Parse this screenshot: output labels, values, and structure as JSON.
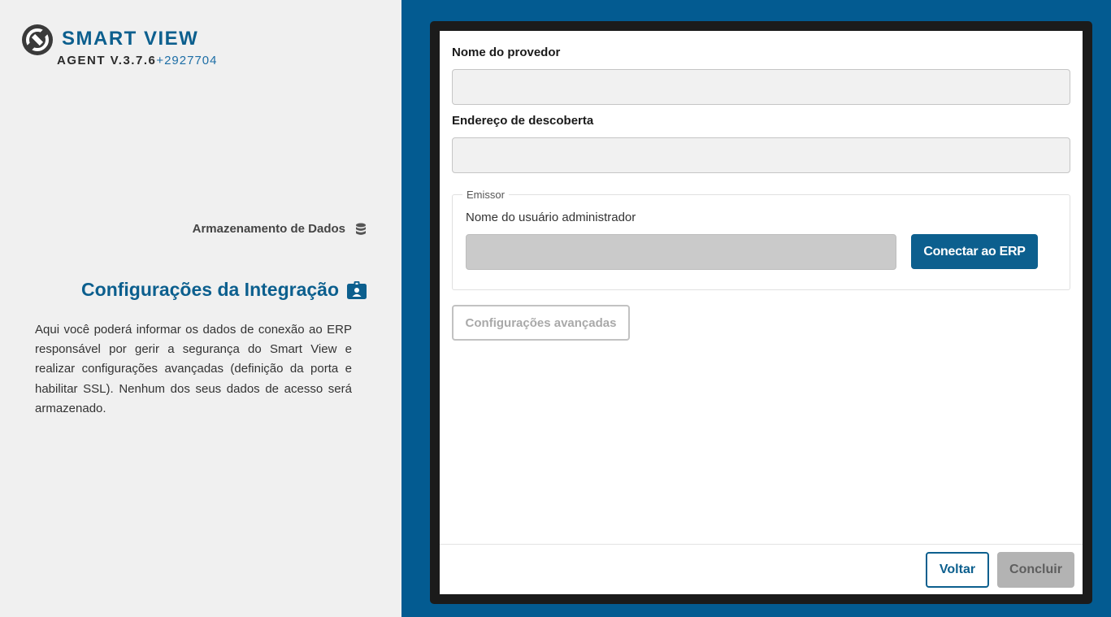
{
  "brand": {
    "name": "SMART VIEW",
    "agent": "AGENT V.3.7.6",
    "build": "+2927704",
    "logo_icon": "totvs-logo-icon"
  },
  "steps": {
    "storage": {
      "label": "Armazenamento de Dados",
      "icon": "database-icon"
    },
    "integration": {
      "label": "Configurações da Integração",
      "icon": "id-badge-icon"
    }
  },
  "description": "Aqui você poderá informar os dados de conexão ao ERP responsável por gerir a segurança do Smart View e realizar configurações avançadas (definição da porta e habilitar SSL). Nenhum dos seus dados de acesso será armazenado.",
  "form": {
    "provider_label": "Nome do provedor",
    "provider_value": "",
    "discovery_label": "Endereço de descoberta",
    "discovery_value": "",
    "issuer": {
      "legend": "Emissor",
      "admin_label": "Nome do usuário administrador",
      "admin_value": "",
      "connect_button": "Conectar ao ERP"
    },
    "advanced_button": "Configurações avançadas"
  },
  "footer": {
    "back_button": "Voltar",
    "finish_button": "Concluir"
  },
  "colors": {
    "primary": "#0c5f8e",
    "background_right": "#035b91",
    "background_left": "#f0f0f0",
    "disabled_button": "#b3b3b3"
  }
}
